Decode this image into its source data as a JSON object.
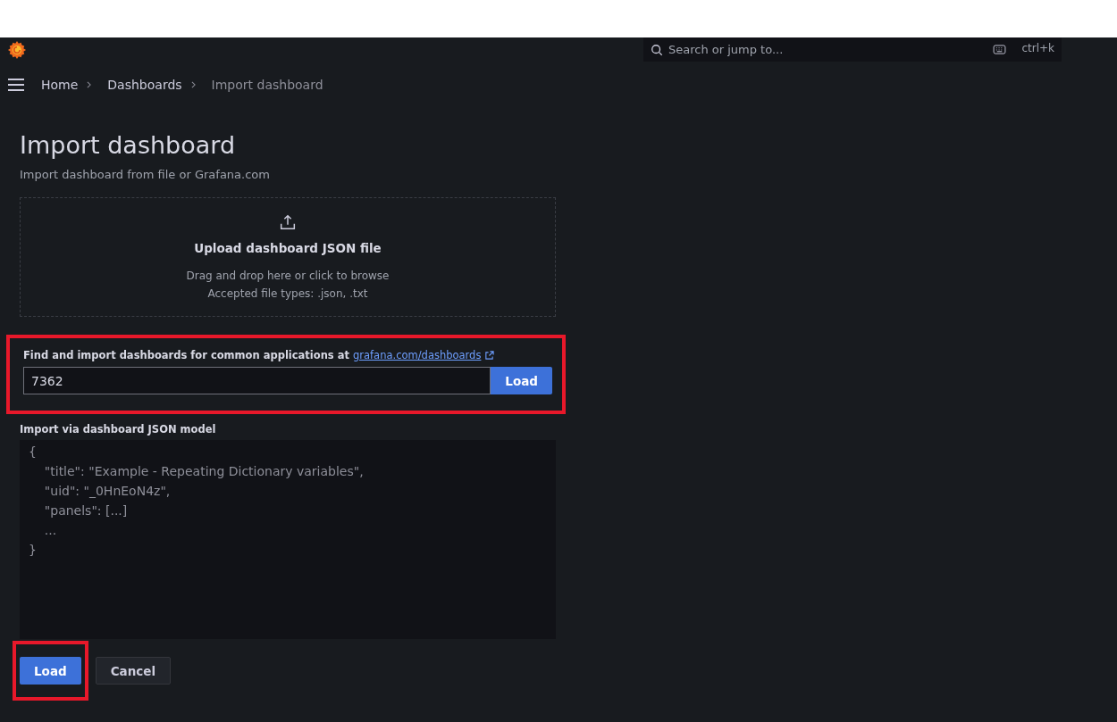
{
  "search": {
    "placeholder": "Search or jump to...",
    "shortcut": "ctrl+k"
  },
  "breadcrumbs": [
    {
      "label": "Home",
      "current": false
    },
    {
      "label": "Dashboards",
      "current": false
    },
    {
      "label": "Import dashboard",
      "current": true
    }
  ],
  "page": {
    "title": "Import dashboard",
    "subtitle": "Import dashboard from file or Grafana.com"
  },
  "upload": {
    "title": "Upload dashboard JSON file",
    "hint": "Drag and drop here or click to browse",
    "types": "Accepted file types: .json, .txt"
  },
  "grafana_import": {
    "label": "Find and import dashboards for common applications at",
    "link": "grafana.com/dashboards",
    "value": "7362",
    "button": "Load",
    "highlighted": true
  },
  "json_model": {
    "label": "Import via dashboard JSON model",
    "placeholder": "{\n    \"title\": \"Example - Repeating Dictionary variables\",\n    \"uid\": \"_0HnEoN4z\",\n    \"panels\": [...]\n    ...\n}"
  },
  "buttons": [
    {
      "label": "Load",
      "kind": "primary",
      "highlighted": true
    },
    {
      "label": "Cancel",
      "kind": "secondary",
      "highlighted": false
    }
  ]
}
